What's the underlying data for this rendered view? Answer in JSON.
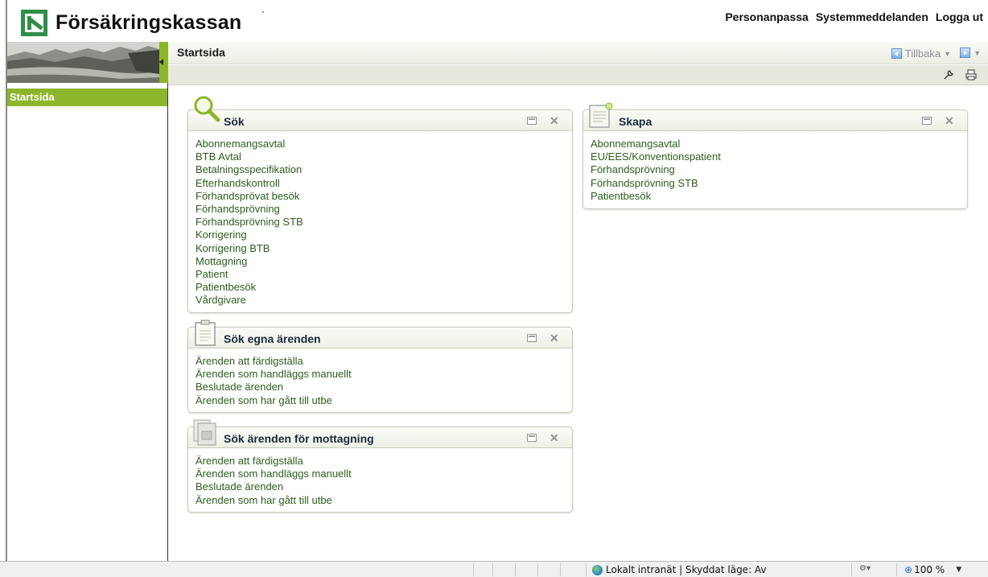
{
  "header": {
    "logo_text": "Försäkringskassan",
    "links": [
      "Personanpassa",
      "Systemmeddelanden",
      "Logga ut"
    ]
  },
  "sidebar": {
    "active_item": "Startsida"
  },
  "page": {
    "title": "Startsida",
    "back_label": "Tillbaka"
  },
  "panels": {
    "sok": {
      "title": "Sök",
      "icon": "magnifier-icon",
      "links": [
        "Abonnemangsavtal",
        "BTB Avtal",
        "Betalningsspecifikation",
        "Efterhandskontroll",
        "Förhandsprövat besök",
        "Förhandsprövning",
        "Förhandsprövning STB",
        "Korrigering",
        "Korrigering BTB",
        "Mottagning",
        "Patient",
        "Patientbesök",
        "Vårdgivare"
      ]
    },
    "sok_egna": {
      "title": "Sök egna ärenden",
      "icon": "clipboard-icon",
      "links": [
        "Ärenden att färdigställa",
        "Ärenden som handläggs manuellt",
        "Beslutade ärenden",
        "Ärenden som har gått till utbe"
      ]
    },
    "sok_mottagning": {
      "title": "Sök ärenden för mottagning",
      "icon": "documents-icon",
      "links": [
        "Ärenden att färdigställa",
        "Ärenden som handläggs manuellt",
        "Beslutade ärenden",
        "Ärenden som har gått till utbe"
      ]
    },
    "skapa": {
      "title": "Skapa",
      "icon": "new-document-icon",
      "links": [
        "Abonnemangsavtal",
        "EU/EES/Konventionspatient",
        "Förhandsprövning",
        "Förhandsprövning STB",
        "Patientbesök"
      ]
    }
  },
  "statusbar": {
    "zone_text": "Lokalt intranät | Skyddat läge: Av",
    "zoom": "100 %"
  },
  "colors": {
    "accent_green": "#8db52b",
    "link_green": "#2c5d1e",
    "logo_green": "#2f8f47"
  }
}
